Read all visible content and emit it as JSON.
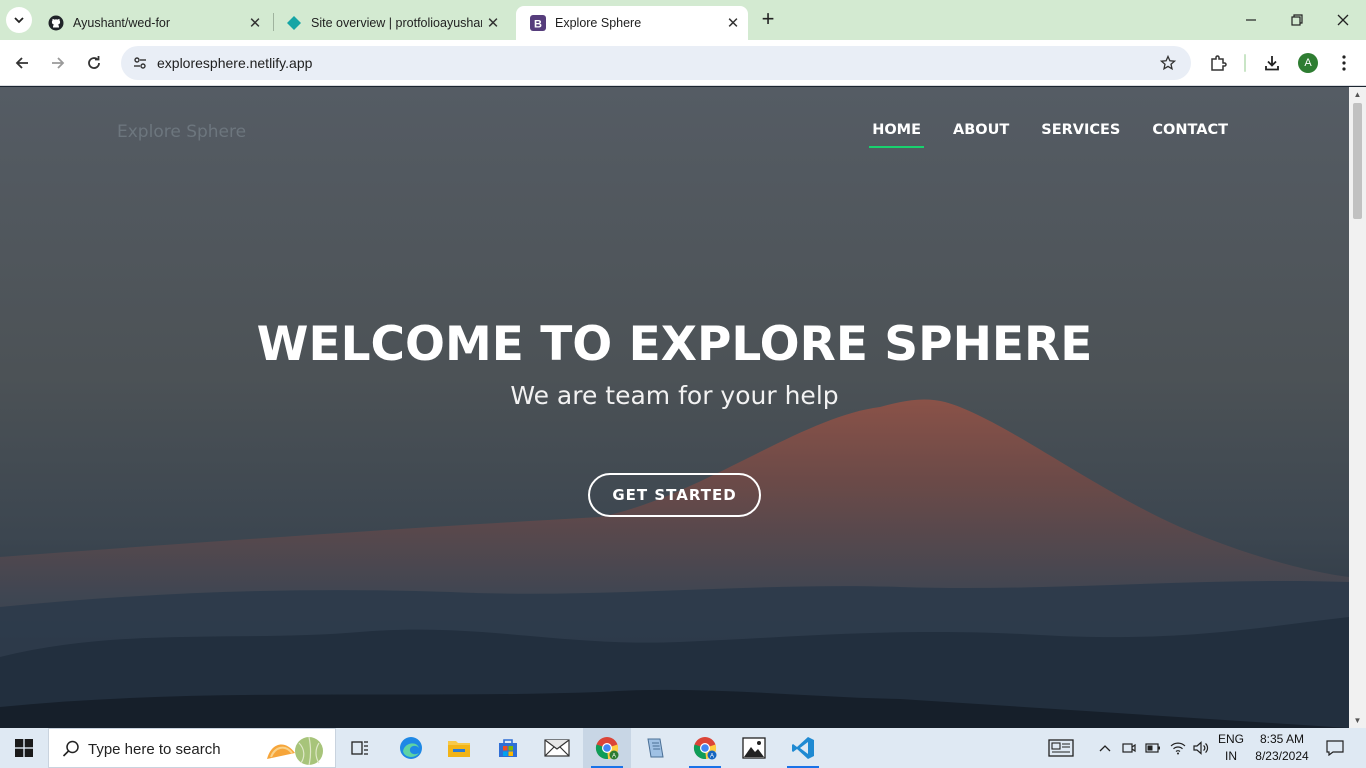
{
  "browser": {
    "tabs": [
      {
        "title": "Ayushant/wed-for",
        "favicon": "github-icon",
        "active": false
      },
      {
        "title": "Site overview | protfolioayushant",
        "favicon": "netlify-icon",
        "active": false
      },
      {
        "title": "Explore Sphere",
        "favicon": "bootstrap-icon",
        "active": true
      }
    ],
    "url": "exploresphere.netlify.app",
    "profile_initial": "A"
  },
  "site": {
    "brand": "Explore Sphere",
    "nav": [
      {
        "label": "HOME",
        "active": true
      },
      {
        "label": "ABOUT",
        "active": false
      },
      {
        "label": "SERVICES",
        "active": false
      },
      {
        "label": "CONTACT",
        "active": false
      }
    ],
    "hero": {
      "title": "WELCOME TO EXPLORE SPHERE",
      "subtitle": "We are team for your help",
      "cta": "GET STARTED"
    },
    "accent_color": "#18d26e"
  },
  "taskbar": {
    "search_placeholder": "Type here to search",
    "apps": [
      "task-view-icon",
      "edge-icon",
      "file-explorer-icon",
      "store-icon",
      "mail-icon",
      "chrome-icon",
      "notepad-icon",
      "chrome-icon",
      "photos-icon",
      "vscode-icon"
    ],
    "lang_primary": "ENG",
    "lang_secondary": "IN",
    "time": "8:35 AM",
    "date": "8/23/2024"
  }
}
